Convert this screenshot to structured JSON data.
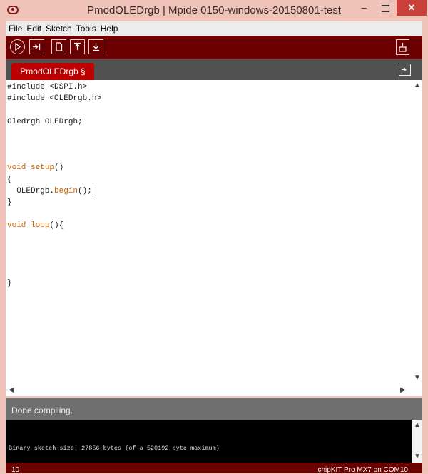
{
  "window": {
    "title": "PmodOLEDrgb | Mpide 0150-windows-20150801-test",
    "minimize": "–",
    "close": "✕"
  },
  "menu": [
    "File",
    "Edit",
    "Sketch",
    "Tools",
    "Help"
  ],
  "toolbar": {
    "buttons": [
      "verify-icon",
      "upload-icon",
      "new-icon",
      "open-icon",
      "save-icon"
    ],
    "right_button": "serial-monitor-icon"
  },
  "tabs": [
    {
      "label": "PmodOLEDrgb §"
    }
  ],
  "editor": {
    "lines": [
      "#include <DSPI.h>",
      "#include <OLEDrgb.h>",
      "",
      "Oledrgb OLEDrgb;",
      "",
      "",
      "",
      "void setup()",
      "{",
      "  OLEDrgb.begin();",
      "}",
      "",
      "void loop(){",
      "",
      "",
      "",
      "",
      "}"
    ],
    "keyword_color": "#cc6600"
  },
  "status": {
    "message": "Done compiling."
  },
  "console": {
    "text": "Binary sketch size: 27856 bytes (of a 520192 byte maximum)"
  },
  "bottom": {
    "line_number": "10",
    "board": "chipKIT Pro MX7 on COM10"
  },
  "colors": {
    "toolbar": "#6c0000",
    "tab": "#bf0000",
    "tabbar": "#515151",
    "status": "#6f6f6f"
  }
}
